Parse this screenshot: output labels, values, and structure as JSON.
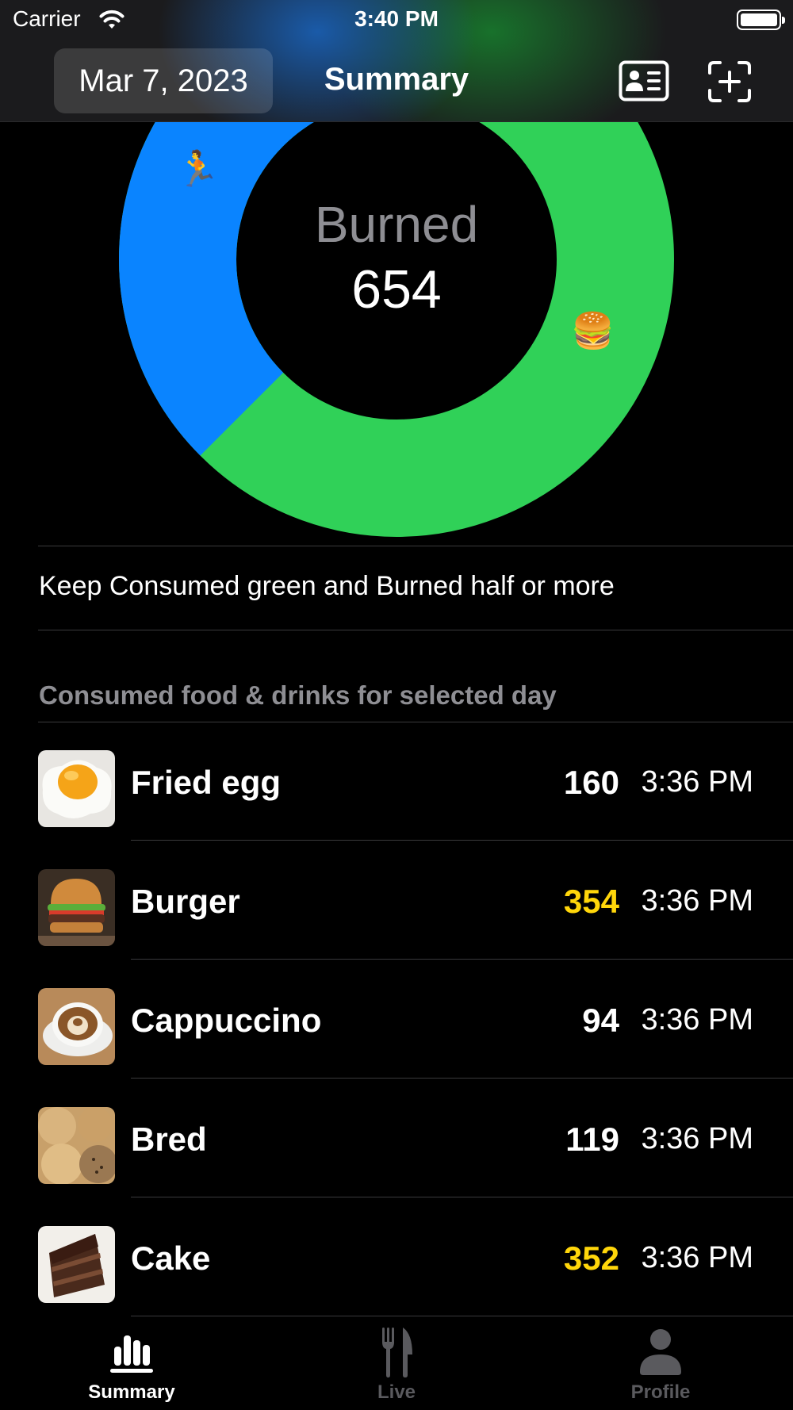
{
  "status_bar": {
    "carrier": "Carrier",
    "time": "3:40 PM"
  },
  "header": {
    "date": "Mar 7, 2023",
    "title": "Summary",
    "profile_card_icon": "person-card-icon",
    "scan_icon": "viewfinder-plus-icon"
  },
  "summary": {
    "label": "Burned",
    "value": "654",
    "consumed_fraction_of_ring": 0.625,
    "burned_color": "#0A84FF",
    "consumed_color": "#30D158"
  },
  "hint": "Keep Consumed green and Burned half or more",
  "section_title": "Consumed food & drinks for selected day",
  "foods": [
    {
      "name": "Fried egg",
      "calories": "160",
      "time": "3:36 PM",
      "highlight": false,
      "icon": "fried-egg-photo"
    },
    {
      "name": "Burger",
      "calories": "354",
      "time": "3:36 PM",
      "highlight": true,
      "icon": "burger-photo"
    },
    {
      "name": "Cappuccino",
      "calories": "94",
      "time": "3:36 PM",
      "highlight": false,
      "icon": "cappuccino-photo"
    },
    {
      "name": "Bred",
      "calories": "119",
      "time": "3:36 PM",
      "highlight": false,
      "icon": "bread-photo"
    },
    {
      "name": "Cake",
      "calories": "352",
      "time": "3:36 PM",
      "highlight": true,
      "icon": "cake-photo"
    }
  ],
  "colors": {
    "highlight_calories": "#FFD60A",
    "normal_calories": "#FFFFFF",
    "active_tab": "#FFFFFF",
    "inactive_tab": "#5A5A5E"
  },
  "tabs": [
    {
      "label": "Summary",
      "icon": "chart-bars-icon",
      "active": true
    },
    {
      "label": "Live",
      "icon": "fork-knife-icon",
      "active": false
    },
    {
      "label": "Profile",
      "icon": "person-icon",
      "active": false
    }
  ]
}
